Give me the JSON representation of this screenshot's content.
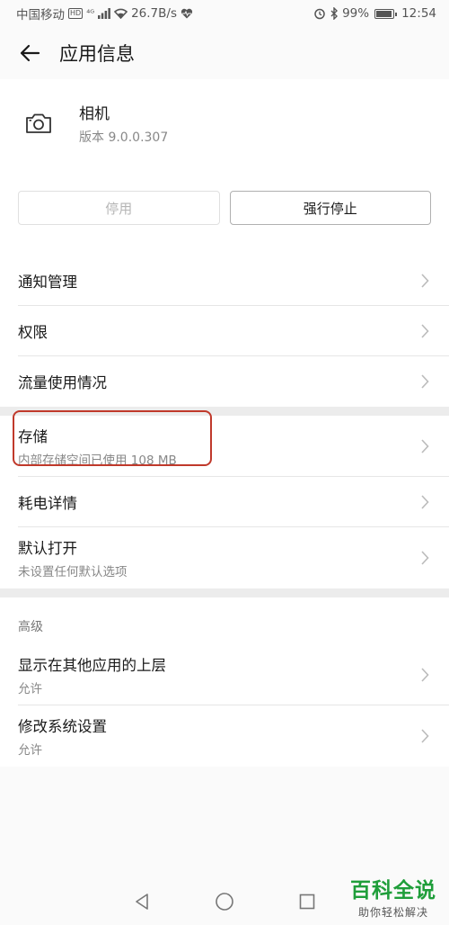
{
  "statusbar": {
    "carrier": "中国移动",
    "hd": "HD",
    "network": "⁴ᴳ",
    "speed": "26.7B/s",
    "battery_pct": "99%",
    "battery_level": 0.99,
    "time": "12:54"
  },
  "appbar": {
    "title": "应用信息"
  },
  "app": {
    "name": "相机",
    "version": "版本 9.0.0.307",
    "icon": "camera-icon"
  },
  "buttons": {
    "disable": "停用",
    "force_stop": "强行停止"
  },
  "group1": [
    {
      "title": "通知管理"
    },
    {
      "title": "权限"
    },
    {
      "title": "流量使用情况"
    }
  ],
  "group2": [
    {
      "title": "存储",
      "subtitle": "内部存储空间已使用 108 MB"
    },
    {
      "title": "耗电详情"
    },
    {
      "title": "默认打开",
      "subtitle": "未设置任何默认选项"
    }
  ],
  "advanced": {
    "label": "高级",
    "items": [
      {
        "title": "显示在其他应用的上层",
        "subtitle": "允许"
      },
      {
        "title": "修改系统设置",
        "subtitle": "允许"
      }
    ]
  },
  "watermark": {
    "title": "百科全说",
    "subtitle": "助你轻松解决"
  },
  "colors": {
    "highlight": "#c0392b",
    "watermark": "#1f9e3a",
    "divider": "#e6e6e6"
  }
}
